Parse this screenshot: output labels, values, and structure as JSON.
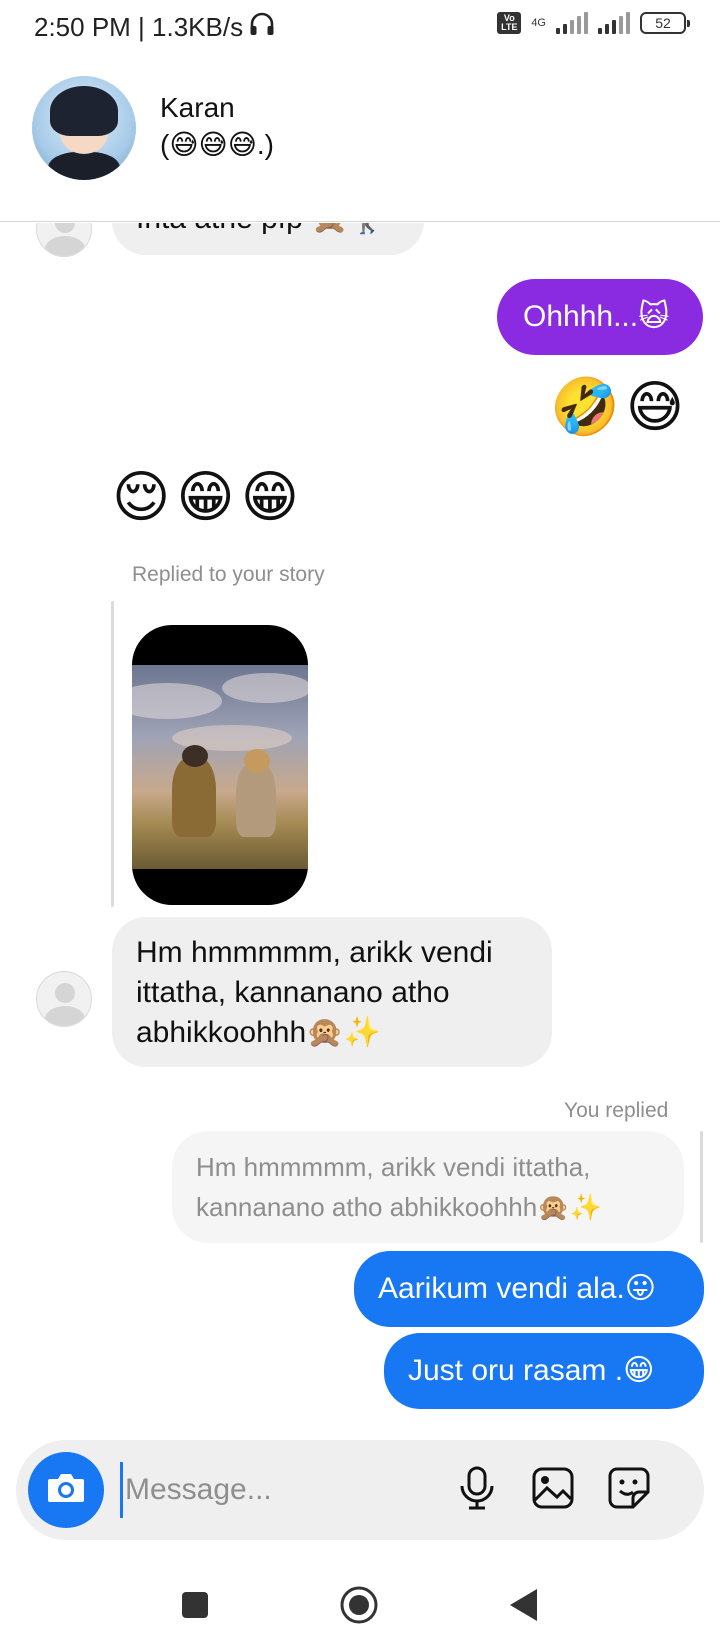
{
  "status_bar": {
    "time_speed": "2:50 PM | 1.3KB/s",
    "volte": "Vo LTE",
    "network": "4G",
    "battery": "52"
  },
  "header": {
    "name": "Karan",
    "status": "(😅😅😅.)"
  },
  "messages": [
    {
      "id": "m1",
      "direction": "incoming",
      "text": "Inta athe pfp 🙊🚶‍♀️"
    },
    {
      "id": "m2",
      "direction": "outgoing",
      "color": "#8a2be2",
      "text": "Ohhhh...🙀"
    },
    {
      "id": "m3",
      "direction": "outgoing",
      "type": "emoji",
      "text": "🤣😅"
    },
    {
      "id": "m4",
      "direction": "incoming",
      "type": "emoji",
      "text": "😌😁😁"
    },
    {
      "id": "m5",
      "direction": "incoming",
      "type": "story_reply",
      "label": "Replied to your story",
      "text": "Hm hmmmmm, arikk vendi ittatha, kannanano atho abhikkoohhh🙊✨"
    },
    {
      "id": "m6",
      "direction": "outgoing",
      "type": "reply",
      "label": "You replied",
      "quoted": "Hm hmmmmm, arikk vendi ittatha, kannanano atho abhikkoohhh🙊✨",
      "color": "#1877f2",
      "text": "Aarikum vendi ala.😛"
    },
    {
      "id": "m7",
      "direction": "outgoing",
      "color": "#1877f2",
      "text": "Just oru rasam .😁"
    }
  ],
  "composer": {
    "placeholder": "Message...",
    "icons": [
      "camera-icon",
      "microphone-icon",
      "gallery-icon",
      "sticker-icon"
    ]
  },
  "nav": {
    "icons": [
      "recents-icon",
      "home-icon",
      "back-icon"
    ]
  },
  "colors": {
    "accent_blue": "#1877f2",
    "accent_purple": "#8a2be2",
    "incoming_bubble": "#efefef"
  }
}
